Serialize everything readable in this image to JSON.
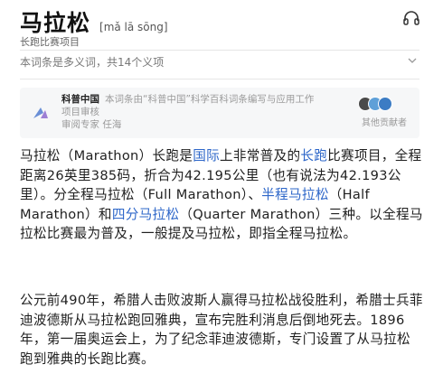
{
  "header": {
    "title": "马拉松",
    "pinyin": "[mǎ lā sōng]",
    "subtitle": "长跑比赛项目"
  },
  "polysemy": {
    "label": "本词条是多义词，共14个义项"
  },
  "source_card": {
    "org": "科普中国",
    "description": "本词条由“科普中国”科学百科词条编写与应用工作项目审核",
    "reviewer": "审阅专家 任海",
    "contributors_label": "其他贡献者"
  },
  "article": {
    "p1": [
      {
        "t": "马拉松（Marathon）长跑是"
      },
      {
        "t": "国际",
        "link": true
      },
      {
        "t": "上非常普及的"
      },
      {
        "t": "长跑",
        "link": true
      },
      {
        "t": "比赛项目，全程距离26英里385码，折合为42.195公里（也有说法为42.193公里）。分全程马拉松（Full Marathon）、"
      },
      {
        "t": "半程马拉松",
        "link": true
      },
      {
        "t": "（Half Marathon）和"
      },
      {
        "t": "四分马拉松",
        "link": true
      },
      {
        "t": "（Quarter Marathon）三种。以全程马拉松比赛最为普及，一般提及马拉松，即指全程马拉松。"
      }
    ],
    "p2": "公元前490年，希腊人击败波斯人赢得马拉松战役胜利，希腊士兵菲迪波德斯从马拉松跑回雅典，宣布完胜利消息后倒地死去。1896年，第一届奥运会上，为了纪念菲迪波德斯，专门设置了从马拉松跑到雅典的长跑比赛。"
  },
  "icons": {
    "listen": "headphones-icon",
    "expand": "chevron-down-icon",
    "logo": "kepu-logo-icon"
  },
  "colors": {
    "link": "#2e67c9",
    "muted": "#9a9a9a",
    "card_bg": "#f6f7f8",
    "avatar1": "#4a4a4a",
    "avatar2": "#5fa0d8",
    "avatar3": "#3c7cc4"
  }
}
